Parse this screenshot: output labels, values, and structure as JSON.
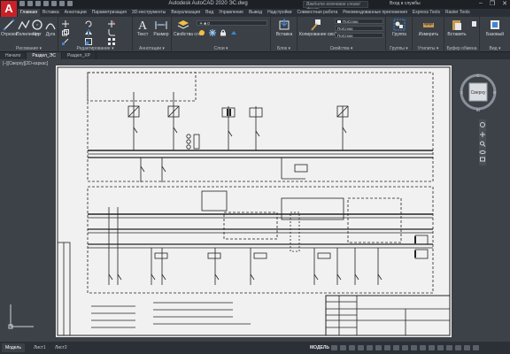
{
  "app": {
    "logo": "A",
    "title": "Autodesk AutoCAD 2020   ЭС.dwg",
    "search_placeholder": "Введите ключевое слово/фразу",
    "signin": "Вход в службы",
    "window_buttons": [
      "–",
      "❐",
      "✕"
    ]
  },
  "ribbon_tabs": [
    "Главная",
    "Вставка",
    "Аннотации",
    "Параметризация",
    "3D-инструменты",
    "Визуализация",
    "Вид",
    "Управление",
    "Вывод",
    "Надстройки",
    "Совместная работа",
    "Рекомендованные приложения",
    "Express Tools",
    "Raster Tools"
  ],
  "active_tab": 0,
  "ribbon": {
    "draw": {
      "tools": [
        "Отрезок",
        "Полилиния",
        "Круг",
        "Дуга"
      ],
      "label": "Рисование ▾"
    },
    "modify": {
      "label": "Редактирование ▾"
    },
    "annotation": {
      "tools": [
        "Текст",
        "Размер"
      ],
      "label": "Аннотации ▾"
    },
    "layers": {
      "tool": "Свойства слоя",
      "label": "Слои ▾"
    },
    "block": {
      "tool": "Вставка",
      "label": "Блок ▾"
    },
    "properties": {
      "tool": "Копирование свойств",
      "color": "ПоСлою",
      "linetype": "ПоСлою",
      "lineweight": "ПоСлою",
      "label": "Свойства ▾"
    },
    "groups": {
      "tool": "Группа",
      "label": "Группы ▾"
    },
    "utilities": {
      "tool": "Измерить",
      "label": "Утилиты ▾"
    },
    "clipboard": {
      "tool": "Вставить",
      "label": "Буфер обмена"
    },
    "view": {
      "tool": "Базовый",
      "label": "Вид ▾"
    }
  },
  "file_tabs": [
    "Начало",
    "Раздел_ЭС",
    "Раздел_ХР"
  ],
  "active_file_tab": 1,
  "viewport": {
    "label": "[–][Сверху][2D-каркас]",
    "viewcube": {
      "face": "Сверху",
      "n": "С",
      "s": "Ю",
      "w": "З",
      "e": "В",
      "wcs": "МСК ▾"
    }
  },
  "layout_tabs": [
    "Модель",
    "Лист1",
    "Лист2"
  ],
  "active_layout": 0,
  "status": {
    "mode": "МОДЕЛЬ"
  },
  "colors": {
    "accent": "#c82127",
    "ribbon": "#3b4047",
    "canvas": "#3d4148",
    "sheet": "#f1f1f1",
    "drawing_line": "#222222"
  }
}
